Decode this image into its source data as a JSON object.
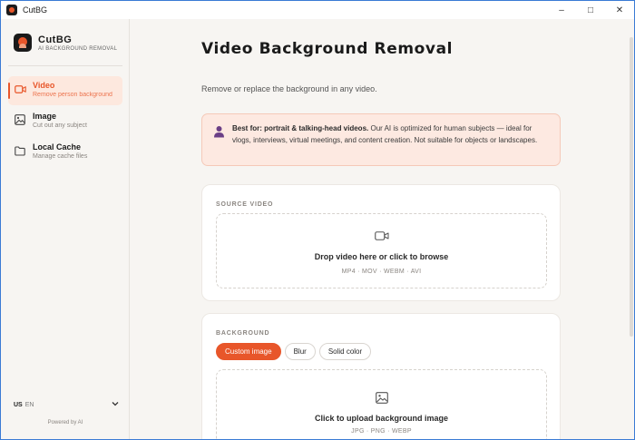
{
  "window": {
    "title": "CutBG",
    "controls": [
      "–",
      "□",
      "✕"
    ]
  },
  "brand": {
    "name": "CutBG",
    "tagline": "AI BACKGROUND REMOVAL"
  },
  "nav": [
    {
      "label": "Video",
      "sub": "Remove person background",
      "icon": "video-icon",
      "active": true
    },
    {
      "label": "Image",
      "sub": "Cut out any subject",
      "icon": "image-icon",
      "active": false
    },
    {
      "label": "Local Cache",
      "sub": "Manage cache files",
      "icon": "folder-icon",
      "active": false
    }
  ],
  "language": {
    "flag": "US",
    "code": "EN"
  },
  "powered": "Powered by AI",
  "page": {
    "title": "Video Background Removal",
    "subtitle": "Remove or replace the background in any video."
  },
  "info": {
    "bold": "Best for: portrait & talking-head videos.",
    "text": " Our AI is optimized for human subjects — ideal for vlogs, interviews, virtual meetings, and content creation. Not suitable for objects or landscapes."
  },
  "source": {
    "label": "SOURCE VIDEO",
    "drop_text": "Drop video here or click to browse",
    "formats": "MP4 · MOV · WEBM · AVI"
  },
  "background": {
    "label": "BACKGROUND",
    "options": [
      "Custom image",
      "Blur",
      "Solid color"
    ],
    "selected": "Custom image",
    "drop_text": "Click to upload background image",
    "formats": "JPG · PNG · WEBP"
  },
  "colors": {
    "accent": "#e8562a",
    "info_bg": "#fde9e1",
    "active_nav_bg": "#fde8de"
  }
}
